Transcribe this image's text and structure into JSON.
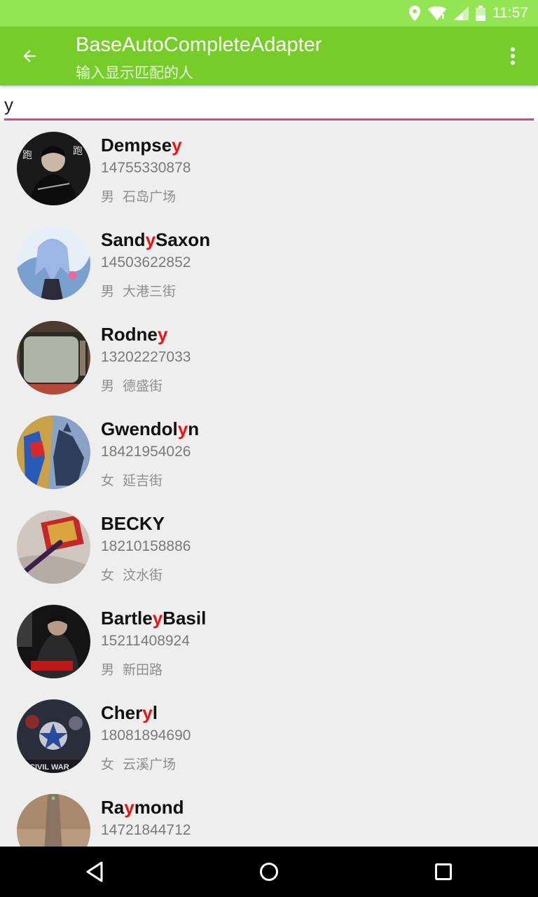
{
  "status_bar": {
    "time": "11:57",
    "icons": [
      "location-icon",
      "wifi-icon",
      "signal-icon",
      "battery-icon"
    ]
  },
  "app_bar": {
    "title": "BaseAutoCompleteAdapter",
    "subtitle": "输入显示匹配的人",
    "back_icon": "arrow-back-icon",
    "menu_icon": "more-vert-icon"
  },
  "search": {
    "value": "y",
    "underline_color": "#e24182"
  },
  "colors": {
    "status_bar": "#94e553",
    "app_bar": "#76cd2a",
    "highlight": "#ee1111",
    "background": "#eeeeee"
  },
  "people": [
    {
      "name_parts": [
        "Dempse",
        "y",
        ""
      ],
      "phone": "14755330878",
      "gender": "男",
      "address": "石岛广场",
      "avatar": "dark-poster"
    },
    {
      "name_parts": [
        "Sand",
        "y",
        "Saxon"
      ],
      "phone": "14503622852",
      "gender": "男",
      "address": "大港三街",
      "avatar": "anime-blue"
    },
    {
      "name_parts": [
        "Rodne",
        "y",
        ""
      ],
      "phone": "13202227033",
      "gender": "男",
      "address": "德盛街",
      "avatar": "old-tv"
    },
    {
      "name_parts": [
        "Gwendol",
        "y",
        "n"
      ],
      "phone": "18421954026",
      "gender": "女",
      "address": "延吉街",
      "avatar": "comic-heroes"
    },
    {
      "name_parts": [
        "BECKY",
        "",
        ""
      ],
      "phone": "18210158886",
      "gender": "女",
      "address": "汶水街",
      "avatar": "red-box"
    },
    {
      "name_parts": [
        "Bartle",
        "y",
        "Basil"
      ],
      "phone": "15211408924",
      "gender": "男",
      "address": "新田路",
      "avatar": "movie-poster"
    },
    {
      "name_parts": [
        "Cher",
        "y",
        "l"
      ],
      "phone": "18081894690",
      "gender": "女",
      "address": "云溪广场",
      "avatar": "civil-war"
    },
    {
      "name_parts": [
        "Ra",
        "y",
        "mond"
      ],
      "phone": "14721844712",
      "gender": "",
      "address": "",
      "avatar": "tower"
    }
  ],
  "nav_bar": {
    "buttons": [
      "back-triangle-icon",
      "home-circle-icon",
      "recents-square-icon"
    ]
  }
}
